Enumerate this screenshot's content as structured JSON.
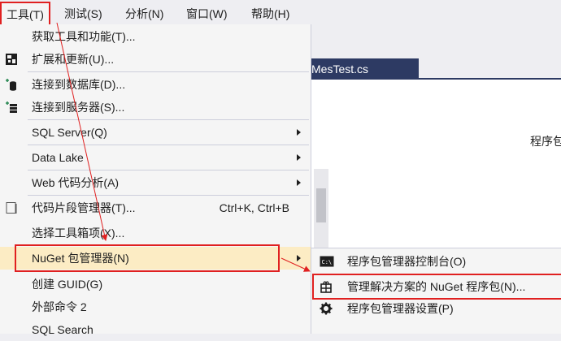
{
  "menubar": {
    "items": [
      {
        "label": "工具(T)"
      },
      {
        "label": "测试(S)"
      },
      {
        "label": "分析(N)"
      },
      {
        "label": "窗口(W)"
      },
      {
        "label": "帮助(H)"
      }
    ]
  },
  "editor": {
    "doc_tab_label": "MesTest.cs",
    "right_text": "程序包"
  },
  "tools_menu": {
    "items": [
      {
        "label": "获取工具和功能(T)..."
      },
      {
        "label": "扩展和更新(U)...",
        "icon": "extensions-icon"
      },
      {
        "label": "连接到数据库(D)...",
        "icon": "database-connect-icon"
      },
      {
        "label": "连接到服务器(S)...",
        "icon": "server-connect-icon"
      },
      {
        "label": "SQL Server(Q)"
      },
      {
        "label": "Data Lake"
      },
      {
        "label": "Web 代码分析(A)"
      },
      {
        "label": "代码片段管理器(T)...",
        "shortcut": "Ctrl+K, Ctrl+B",
        "icon": "snippet-icon"
      },
      {
        "label": "选择工具箱项(X)..."
      },
      {
        "label": "NuGet 包管理器(N)"
      },
      {
        "label": "创建 GUID(G)"
      },
      {
        "label": "外部命令 2"
      },
      {
        "label": "SQL Search"
      }
    ]
  },
  "nuget_submenu": {
    "items": [
      {
        "label": "程序包管理器控制台(O)",
        "icon": "console-icon"
      },
      {
        "label": "管理解决方案的 NuGet 程序包(N)...",
        "icon": "package-icon"
      },
      {
        "label": "程序包管理器设置(P)",
        "icon": "gear-icon"
      }
    ]
  },
  "colors": {
    "menu_bg": "#f5f5f5",
    "highlight_bg": "#fcecc4",
    "annotation_red": "#e02020",
    "tab_navy": "#2d3a63"
  }
}
